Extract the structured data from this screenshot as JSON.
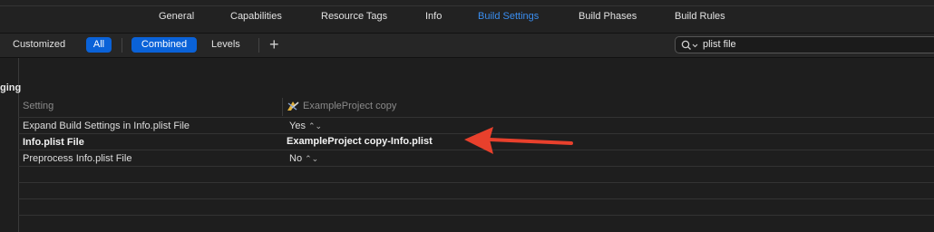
{
  "tabs": [
    {
      "label": "General",
      "active": false
    },
    {
      "label": "Capabilities",
      "active": false
    },
    {
      "label": "Resource Tags",
      "active": false
    },
    {
      "label": "Info",
      "active": false
    },
    {
      "label": "Build Settings",
      "active": true
    },
    {
      "label": "Build Phases",
      "active": false
    },
    {
      "label": "Build Rules",
      "active": false
    }
  ],
  "filter": {
    "customized": "Customized",
    "all": "All",
    "combined": "Combined",
    "levels": "Levels",
    "add": "+"
  },
  "search": {
    "value": "plist file",
    "icon": "search-icon"
  },
  "section": {
    "title": "ging"
  },
  "columns": {
    "setting": "Setting",
    "project": "ExampleProject copy",
    "project_icon": "xcode-project-icon"
  },
  "rows": [
    {
      "label": "Expand Build Settings in Info.plist File",
      "value": "Yes",
      "bold": false,
      "stepper": true
    },
    {
      "label": "Info.plist File",
      "value": "ExampleProject copy-Info.plist",
      "bold": true,
      "stepper": false
    },
    {
      "label": "Preprocess Info.plist File",
      "value": "No",
      "bold": false,
      "stepper": true
    }
  ],
  "stepper_glyph": "⌃⌄",
  "colors": {
    "accent": "#3a8ef0",
    "pill": "#0a62d8",
    "arrow": "#e8402c"
  }
}
